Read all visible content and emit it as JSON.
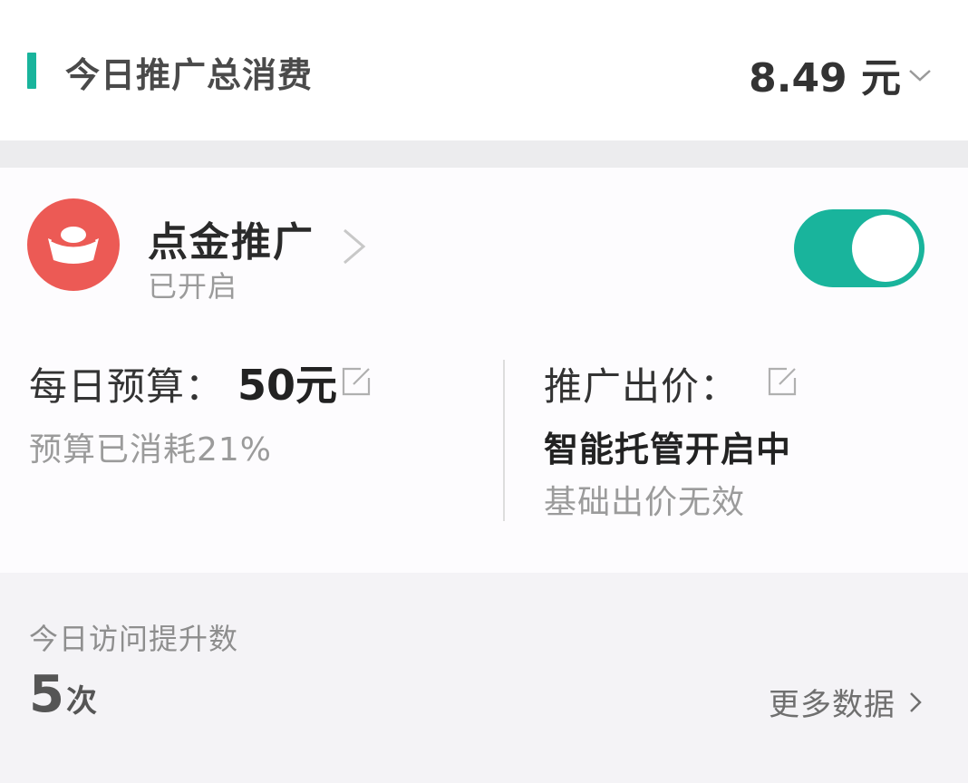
{
  "summary": {
    "title": "今日推广总消费",
    "amount": "8.49 元",
    "accent_color": "#19b49c",
    "dropdown_icon": "chevron-down-icon"
  },
  "promotion": {
    "icon": "gold-ingot-icon",
    "icon_bg_color": "#ec5a55",
    "name": "点金推广",
    "status": "已开启",
    "toggle_on": true,
    "toggle_color": "#19b49c",
    "budget": {
      "label": "每日预算：",
      "value": "50元",
      "used_text": "预算已消耗21%",
      "used_percent": 21
    },
    "bid": {
      "label": "推广出价：",
      "mode": "智能托管开启中",
      "note": "基础出价无效"
    }
  },
  "stats": {
    "label": "今日访问提升数",
    "number": "5",
    "unit": "次",
    "more_label": "更多数据"
  }
}
